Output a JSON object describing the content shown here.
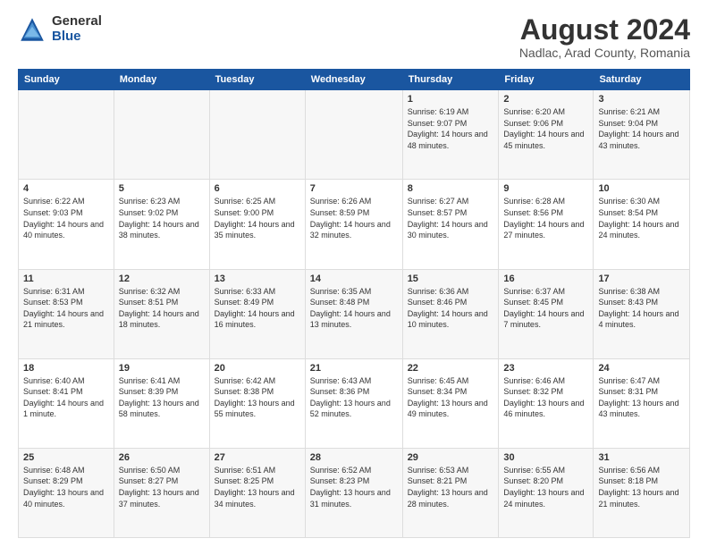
{
  "header": {
    "logo_general": "General",
    "logo_blue": "Blue",
    "month_title": "August 2024",
    "location": "Nadlac, Arad County, Romania"
  },
  "calendar": {
    "days_of_week": [
      "Sunday",
      "Monday",
      "Tuesday",
      "Wednesday",
      "Thursday",
      "Friday",
      "Saturday"
    ],
    "weeks": [
      [
        {
          "day": "",
          "info": ""
        },
        {
          "day": "",
          "info": ""
        },
        {
          "day": "",
          "info": ""
        },
        {
          "day": "",
          "info": ""
        },
        {
          "day": "1",
          "info": "Sunrise: 6:19 AM\nSunset: 9:07 PM\nDaylight: 14 hours\nand 48 minutes."
        },
        {
          "day": "2",
          "info": "Sunrise: 6:20 AM\nSunset: 9:06 PM\nDaylight: 14 hours\nand 45 minutes."
        },
        {
          "day": "3",
          "info": "Sunrise: 6:21 AM\nSunset: 9:04 PM\nDaylight: 14 hours\nand 43 minutes."
        }
      ],
      [
        {
          "day": "4",
          "info": "Sunrise: 6:22 AM\nSunset: 9:03 PM\nDaylight: 14 hours\nand 40 minutes."
        },
        {
          "day": "5",
          "info": "Sunrise: 6:23 AM\nSunset: 9:02 PM\nDaylight: 14 hours\nand 38 minutes."
        },
        {
          "day": "6",
          "info": "Sunrise: 6:25 AM\nSunset: 9:00 PM\nDaylight: 14 hours\nand 35 minutes."
        },
        {
          "day": "7",
          "info": "Sunrise: 6:26 AM\nSunset: 8:59 PM\nDaylight: 14 hours\nand 32 minutes."
        },
        {
          "day": "8",
          "info": "Sunrise: 6:27 AM\nSunset: 8:57 PM\nDaylight: 14 hours\nand 30 minutes."
        },
        {
          "day": "9",
          "info": "Sunrise: 6:28 AM\nSunset: 8:56 PM\nDaylight: 14 hours\nand 27 minutes."
        },
        {
          "day": "10",
          "info": "Sunrise: 6:30 AM\nSunset: 8:54 PM\nDaylight: 14 hours\nand 24 minutes."
        }
      ],
      [
        {
          "day": "11",
          "info": "Sunrise: 6:31 AM\nSunset: 8:53 PM\nDaylight: 14 hours\nand 21 minutes."
        },
        {
          "day": "12",
          "info": "Sunrise: 6:32 AM\nSunset: 8:51 PM\nDaylight: 14 hours\nand 18 minutes."
        },
        {
          "day": "13",
          "info": "Sunrise: 6:33 AM\nSunset: 8:49 PM\nDaylight: 14 hours\nand 16 minutes."
        },
        {
          "day": "14",
          "info": "Sunrise: 6:35 AM\nSunset: 8:48 PM\nDaylight: 14 hours\nand 13 minutes."
        },
        {
          "day": "15",
          "info": "Sunrise: 6:36 AM\nSunset: 8:46 PM\nDaylight: 14 hours\nand 10 minutes."
        },
        {
          "day": "16",
          "info": "Sunrise: 6:37 AM\nSunset: 8:45 PM\nDaylight: 14 hours\nand 7 minutes."
        },
        {
          "day": "17",
          "info": "Sunrise: 6:38 AM\nSunset: 8:43 PM\nDaylight: 14 hours\nand 4 minutes."
        }
      ],
      [
        {
          "day": "18",
          "info": "Sunrise: 6:40 AM\nSunset: 8:41 PM\nDaylight: 14 hours\nand 1 minute."
        },
        {
          "day": "19",
          "info": "Sunrise: 6:41 AM\nSunset: 8:39 PM\nDaylight: 13 hours\nand 58 minutes."
        },
        {
          "day": "20",
          "info": "Sunrise: 6:42 AM\nSunset: 8:38 PM\nDaylight: 13 hours\nand 55 minutes."
        },
        {
          "day": "21",
          "info": "Sunrise: 6:43 AM\nSunset: 8:36 PM\nDaylight: 13 hours\nand 52 minutes."
        },
        {
          "day": "22",
          "info": "Sunrise: 6:45 AM\nSunset: 8:34 PM\nDaylight: 13 hours\nand 49 minutes."
        },
        {
          "day": "23",
          "info": "Sunrise: 6:46 AM\nSunset: 8:32 PM\nDaylight: 13 hours\nand 46 minutes."
        },
        {
          "day": "24",
          "info": "Sunrise: 6:47 AM\nSunset: 8:31 PM\nDaylight: 13 hours\nand 43 minutes."
        }
      ],
      [
        {
          "day": "25",
          "info": "Sunrise: 6:48 AM\nSunset: 8:29 PM\nDaylight: 13 hours\nand 40 minutes."
        },
        {
          "day": "26",
          "info": "Sunrise: 6:50 AM\nSunset: 8:27 PM\nDaylight: 13 hours\nand 37 minutes."
        },
        {
          "day": "27",
          "info": "Sunrise: 6:51 AM\nSunset: 8:25 PM\nDaylight: 13 hours\nand 34 minutes."
        },
        {
          "day": "28",
          "info": "Sunrise: 6:52 AM\nSunset: 8:23 PM\nDaylight: 13 hours\nand 31 minutes."
        },
        {
          "day": "29",
          "info": "Sunrise: 6:53 AM\nSunset: 8:21 PM\nDaylight: 13 hours\nand 28 minutes."
        },
        {
          "day": "30",
          "info": "Sunrise: 6:55 AM\nSunset: 8:20 PM\nDaylight: 13 hours\nand 24 minutes."
        },
        {
          "day": "31",
          "info": "Sunrise: 6:56 AM\nSunset: 8:18 PM\nDaylight: 13 hours\nand 21 minutes."
        }
      ]
    ]
  }
}
